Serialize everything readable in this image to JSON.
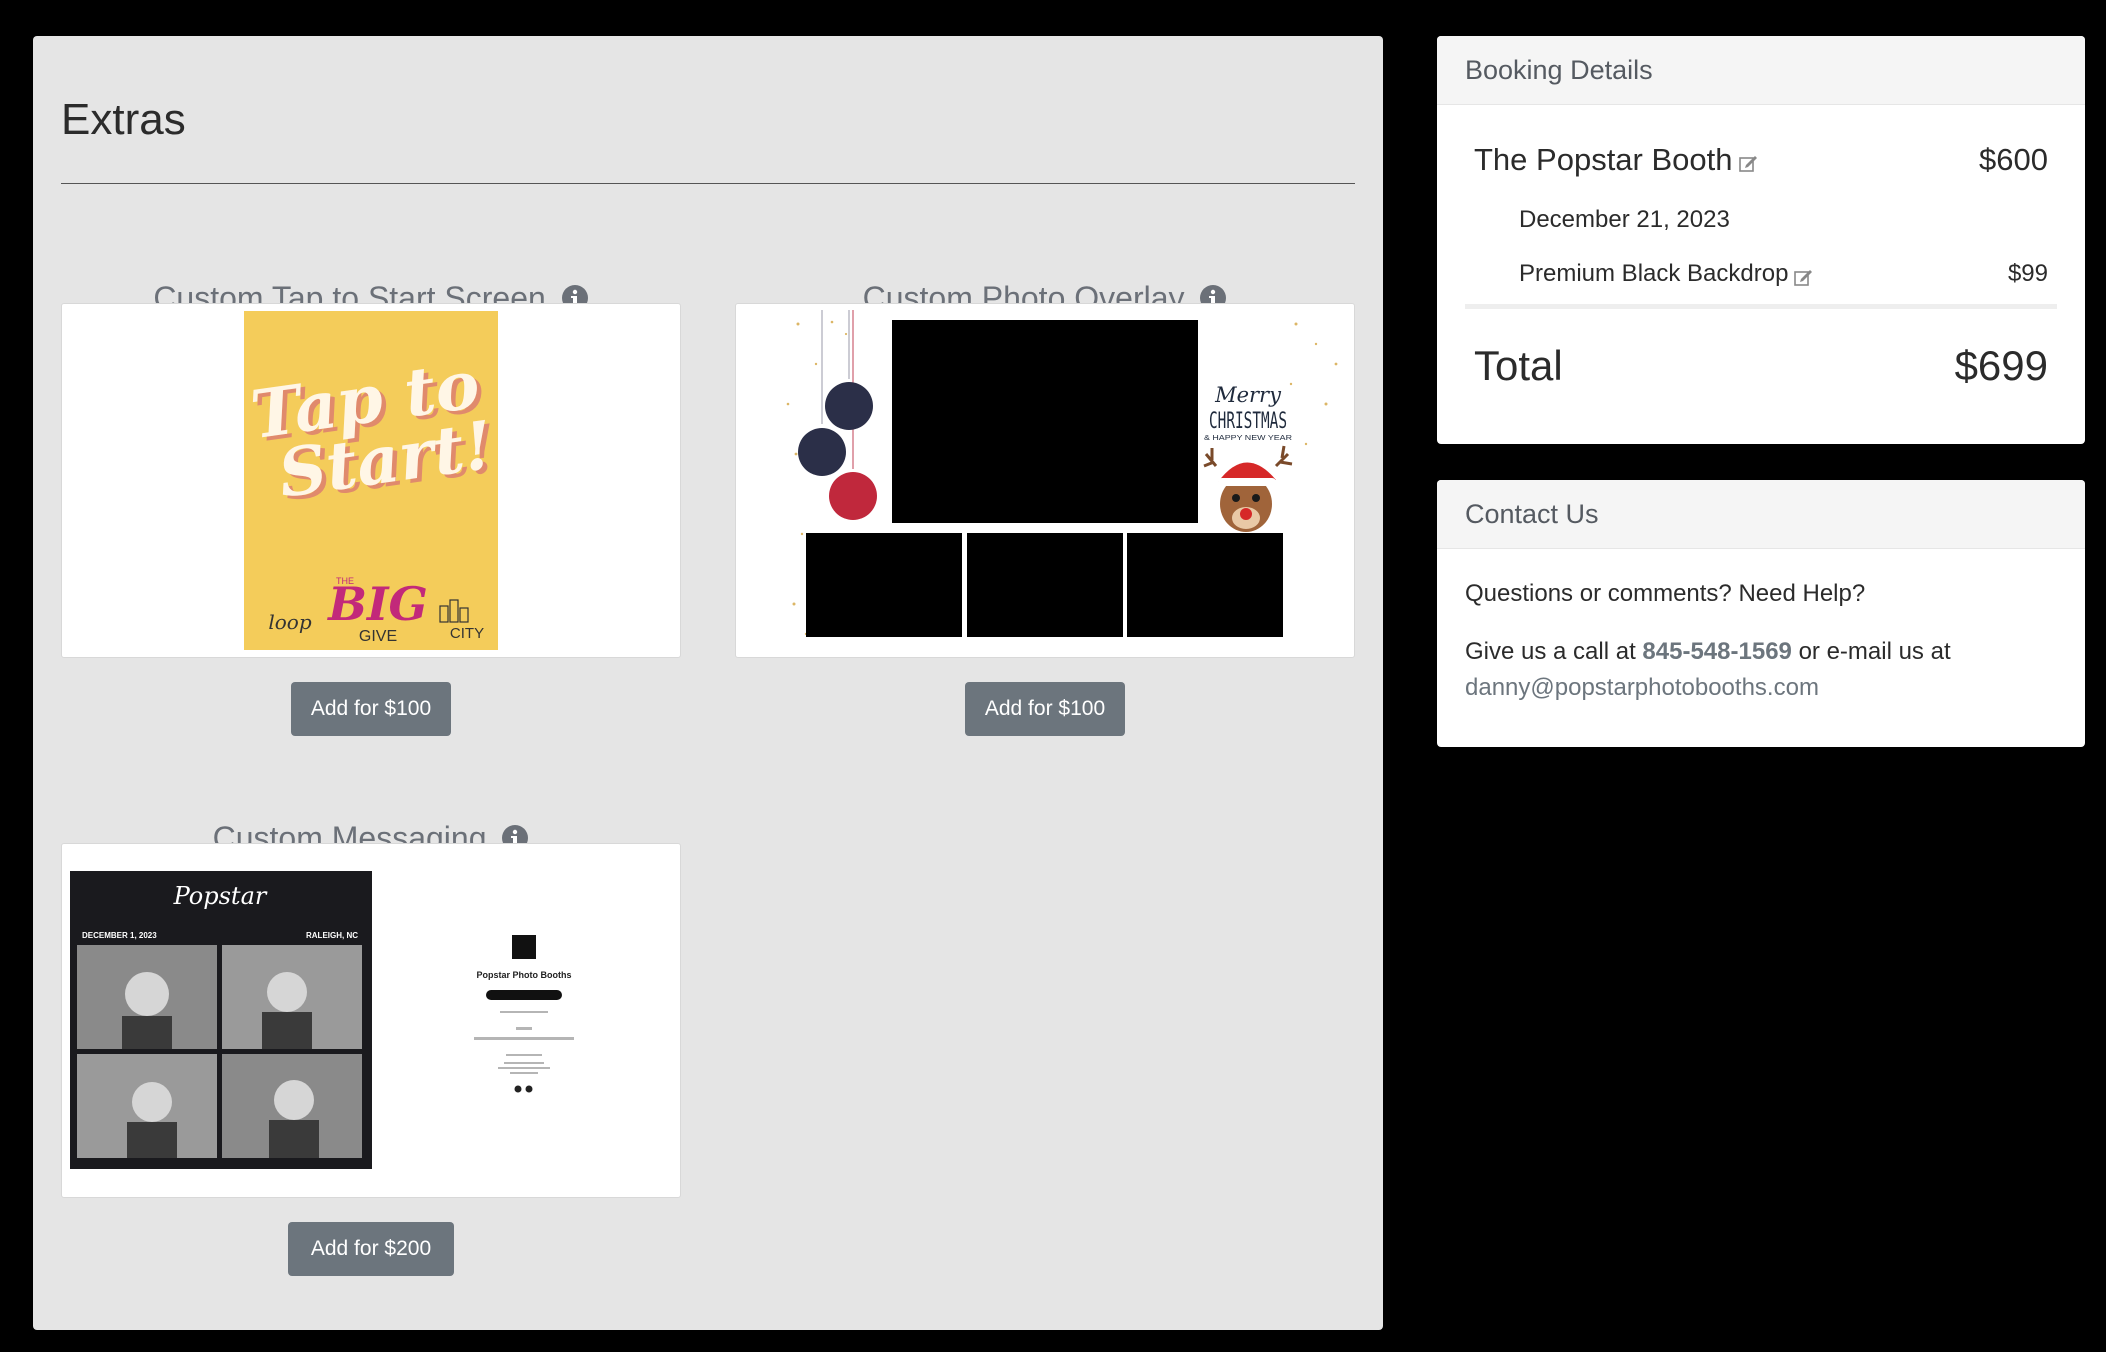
{
  "extras": {
    "title": "Extras",
    "items": [
      {
        "title": "Custom Tap to Start Screen",
        "button_label": "Add for $100",
        "preview": {
          "headline_line1": "Tap to",
          "headline_line2": "Start!",
          "logo_left": "loop",
          "logo_center_small": "THE",
          "logo_center_big": "BIG",
          "logo_center_bottom": "GIVE",
          "logo_right": "CITY"
        }
      },
      {
        "title": "Custom Photo Overlay",
        "button_label": "Add for $100",
        "preview": {
          "greeting_script": "Merry",
          "greeting_main": "CHRISTMAS",
          "greeting_sub": "& HAPPY NEW YEAR"
        }
      },
      {
        "title": "Custom Messaging",
        "button_label": "Add for $200",
        "preview": {
          "strip_logo": "Popstar",
          "strip_date": "DECEMBER 1, 2023",
          "strip_location": "RALEIGH, NC",
          "message_brand": "Popstar Photo Booths"
        }
      }
    ]
  },
  "booking": {
    "header": "Booking Details",
    "package_name": "The Popstar Booth",
    "package_price": "$600",
    "event_date": "December 21, 2023",
    "addon_name": "Premium Black Backdrop",
    "addon_price": "$99",
    "total_label": "Total",
    "total_value": "$699"
  },
  "contact": {
    "header": "Contact Us",
    "line1": "Questions or comments? Need Help?",
    "call_prefix": "Give us a call at",
    "phone": "845-548-1569",
    "email_prefix": "or e-mail us at",
    "email": "danny@popstarphotobooths.com"
  },
  "colors": {
    "button": "#6c757d",
    "panel": "#e5e5e5",
    "tap_bg": "#f4cc5a",
    "big_give": "#c2297a"
  },
  "icons": [
    "info-icon",
    "edit-icon"
  ]
}
